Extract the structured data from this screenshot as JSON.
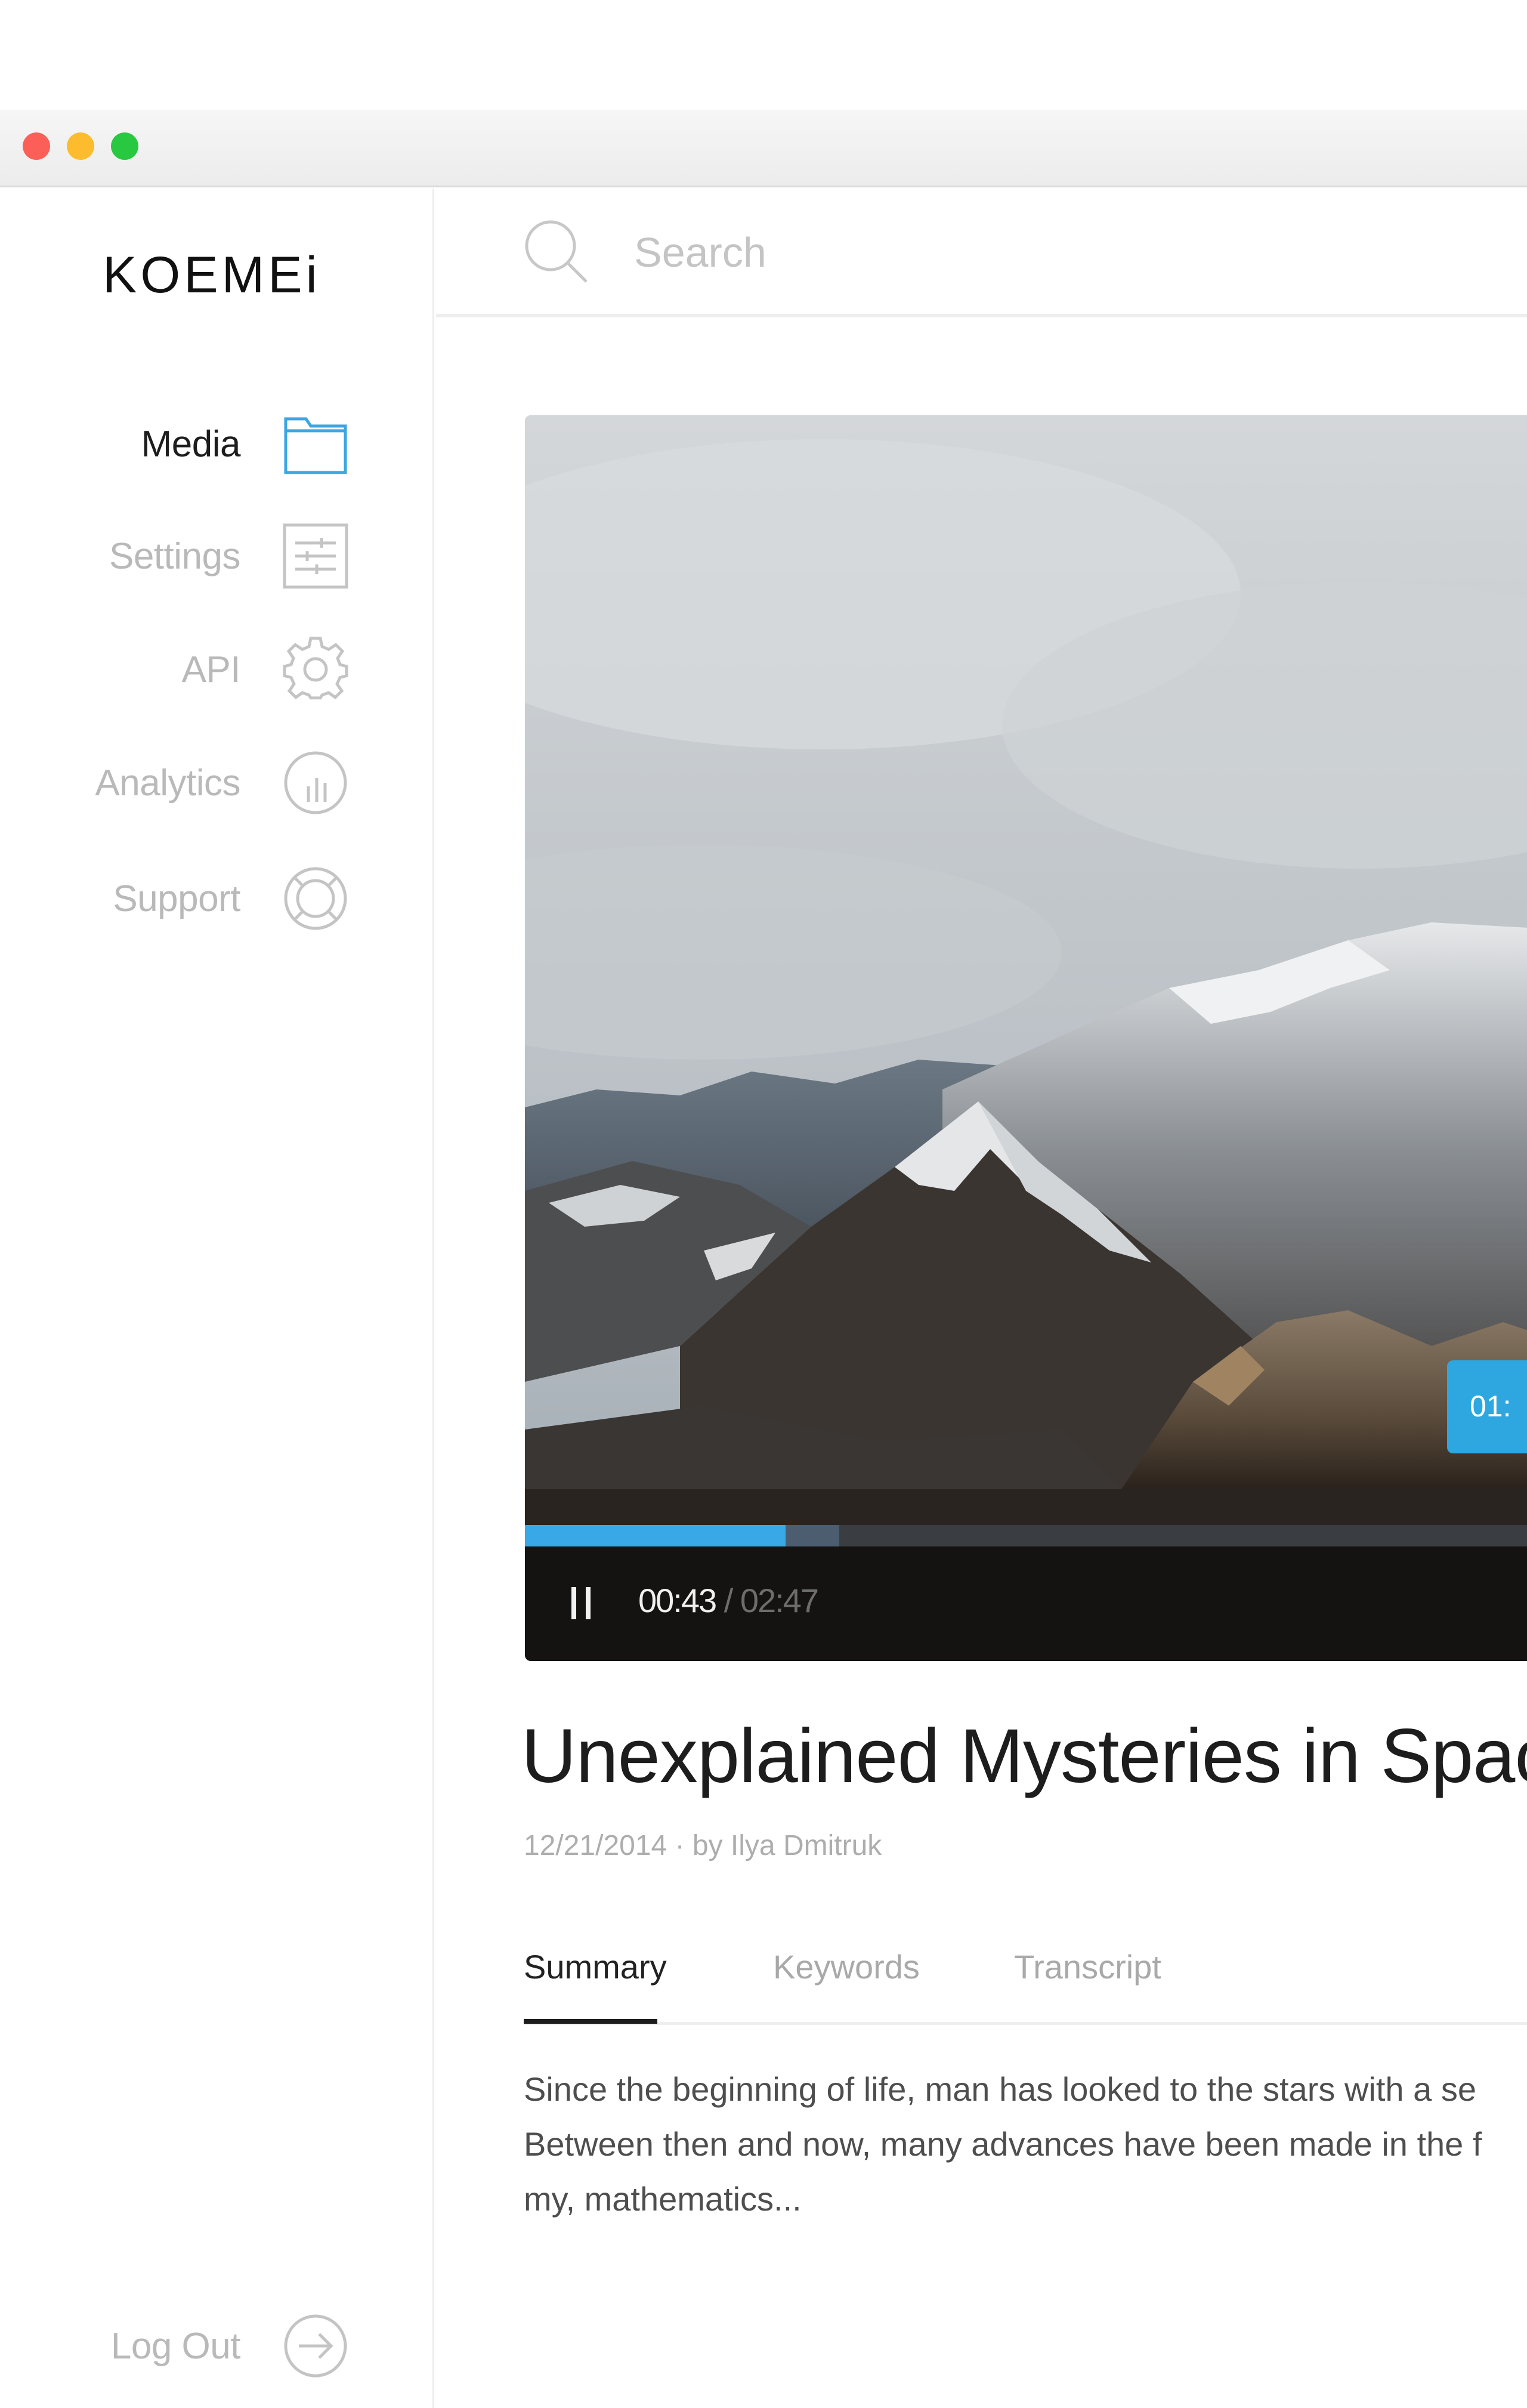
{
  "window": {
    "traffic_lights": {
      "close": "#fc5f57",
      "minimize": "#fdbc2e",
      "zoom": "#28c840"
    }
  },
  "sidebar": {
    "logo": "KOEMEi",
    "accent_color": "#3aa6e2",
    "items": [
      {
        "label": "Media",
        "icon": "folder-icon",
        "active": true
      },
      {
        "label": "Settings",
        "icon": "sliders-icon",
        "active": false
      },
      {
        "label": "API",
        "icon": "gear-icon",
        "active": false
      },
      {
        "label": "Analytics",
        "icon": "bar-chart-icon",
        "active": false
      },
      {
        "label": "Support",
        "icon": "lifebuoy-icon",
        "active": false
      }
    ],
    "logout": {
      "label": "Log Out",
      "icon": "arrow-right-circle-icon"
    }
  },
  "search": {
    "placeholder": "Search",
    "value": ""
  },
  "player": {
    "current_time": "00:43",
    "separator": " / ",
    "duration": "02:47",
    "hover_time_partial": "01:",
    "progress_fraction": 0.257,
    "buffer_fraction": 0.31,
    "progress_color": "#38a9e6"
  },
  "video": {
    "title": "Unexplained Mysteries in Space",
    "meta": "12/21/2014 · by Ilya Dmitruk"
  },
  "tabs": [
    {
      "label": "Summary",
      "active": true
    },
    {
      "label": "Keywords",
      "active": false
    },
    {
      "label": "Transcript",
      "active": false
    }
  ],
  "summary": {
    "lines": [
      "Since the beginning of life, man has looked to the stars with a se",
      "Between then and now, many advances have been made in the f",
      "my, mathematics..."
    ]
  }
}
